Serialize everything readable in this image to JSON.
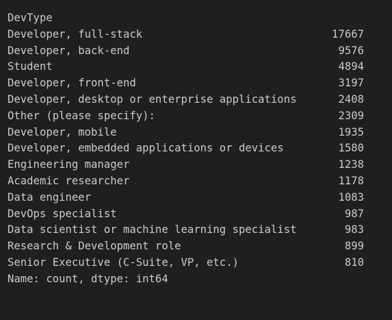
{
  "output": {
    "header": "DevType",
    "rows": [
      {
        "label": "Developer, full-stack",
        "value": "17667"
      },
      {
        "label": "Developer, back-end",
        "value": "9576"
      },
      {
        "label": "Student",
        "value": "4894"
      },
      {
        "label": "Developer, front-end",
        "value": "3197"
      },
      {
        "label": "Developer, desktop or enterprise applications",
        "value": "2408"
      },
      {
        "label": "Other (please specify):",
        "value": "2309"
      },
      {
        "label": "Developer, mobile",
        "value": "1935"
      },
      {
        "label": "Developer, embedded applications or devices",
        "value": "1580"
      },
      {
        "label": "Engineering manager",
        "value": "1238"
      },
      {
        "label": "Academic researcher",
        "value": "1178"
      },
      {
        "label": "Data engineer",
        "value": "1083"
      },
      {
        "label": "DevOps specialist",
        "value": "987"
      },
      {
        "label": "Data scientist or machine learning specialist",
        "value": "983"
      },
      {
        "label": "Research & Development role",
        "value": "899"
      },
      {
        "label": "Senior Executive (C-Suite, VP, etc.)",
        "value": "810"
      }
    ],
    "footer": "Name: count, dtype: int64"
  },
  "colors": {
    "background": "#1f1f1f",
    "text": "#cccccc"
  }
}
